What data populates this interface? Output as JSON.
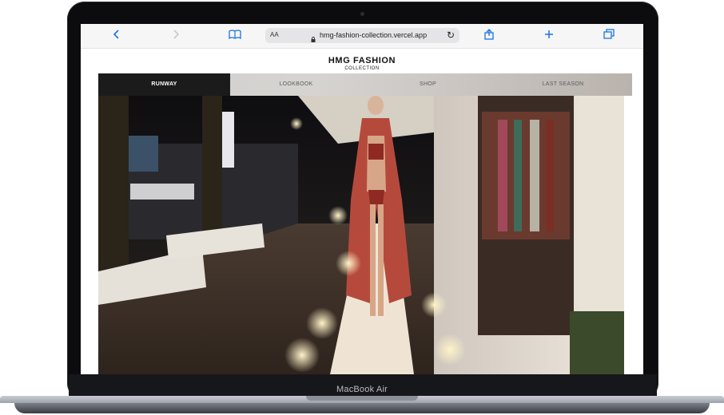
{
  "device": {
    "label": "MacBook Air"
  },
  "browser": {
    "address_font_size_label": "AA",
    "url": "hmg-fashion-collection.vercel.app",
    "icons": [
      "back-icon",
      "forward-icon",
      "bookmarks-icon",
      "lock-icon",
      "reload-icon",
      "share-icon",
      "add-tab-icon",
      "tabs-icon"
    ]
  },
  "site": {
    "title": "HMG FASHION",
    "subtitle": "COLLECTION",
    "nav": [
      {
        "label": "RUNWAY",
        "active": true
      },
      {
        "label": "LOOKBOOK",
        "active": false
      },
      {
        "label": "SHOP",
        "active": false
      },
      {
        "label": "LAST SEASON",
        "active": false
      }
    ]
  },
  "colors": {
    "accent": "#1a73e8",
    "nav_active": "#1b1b1b"
  }
}
